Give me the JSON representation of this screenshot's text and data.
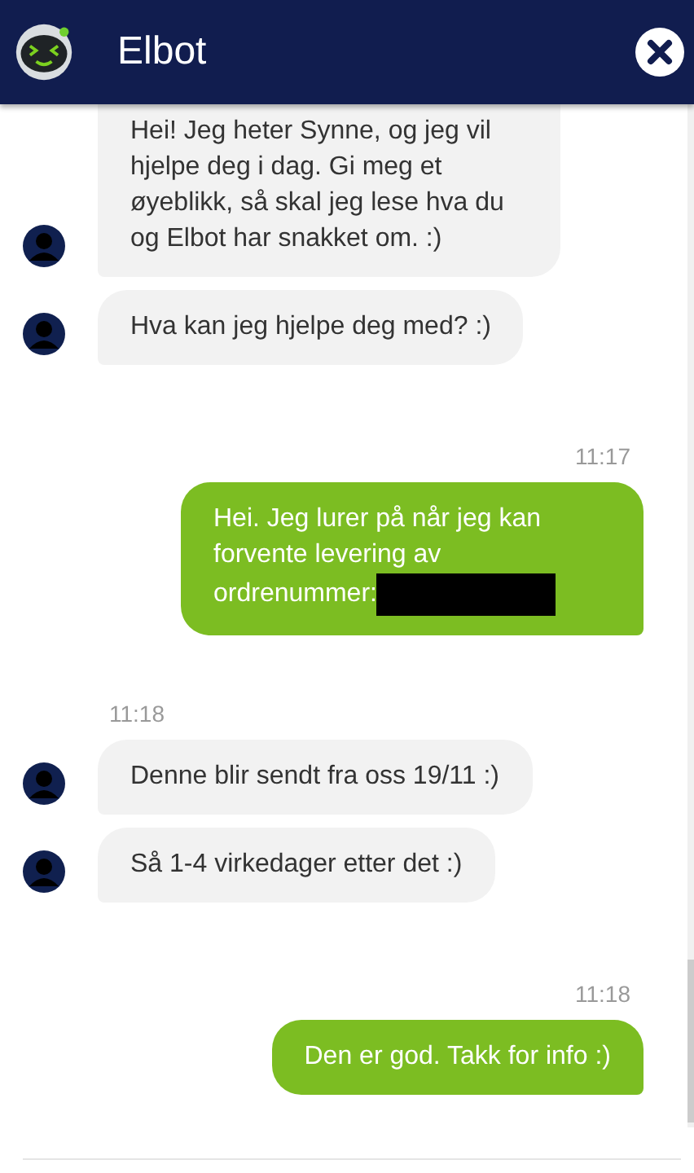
{
  "header": {
    "title": "Elbot"
  },
  "messages": [
    {
      "kind": "agent",
      "text": "Hei! Jeg heter Synne, og jeg vil hjelpe deg i dag. Gi meg et øyeblikk, så skal jeg lese hva du og Elbot har snakket om. :)"
    },
    {
      "kind": "agent",
      "text": "Hva kan jeg hjelpe deg med? :)"
    },
    {
      "kind": "user",
      "time": "11:17",
      "text": "Hei. Jeg lurer på når jeg kan forvente levering av ordrenummer:",
      "redacted": true
    },
    {
      "kind": "agent",
      "time": "11:18",
      "text": "Denne blir sendt fra oss 19/11 :)"
    },
    {
      "kind": "agent",
      "text": "Så 1-4 virkedager etter det :)"
    },
    {
      "kind": "user",
      "time": "11:18",
      "text": "Den er god. Takk for info :)"
    }
  ]
}
